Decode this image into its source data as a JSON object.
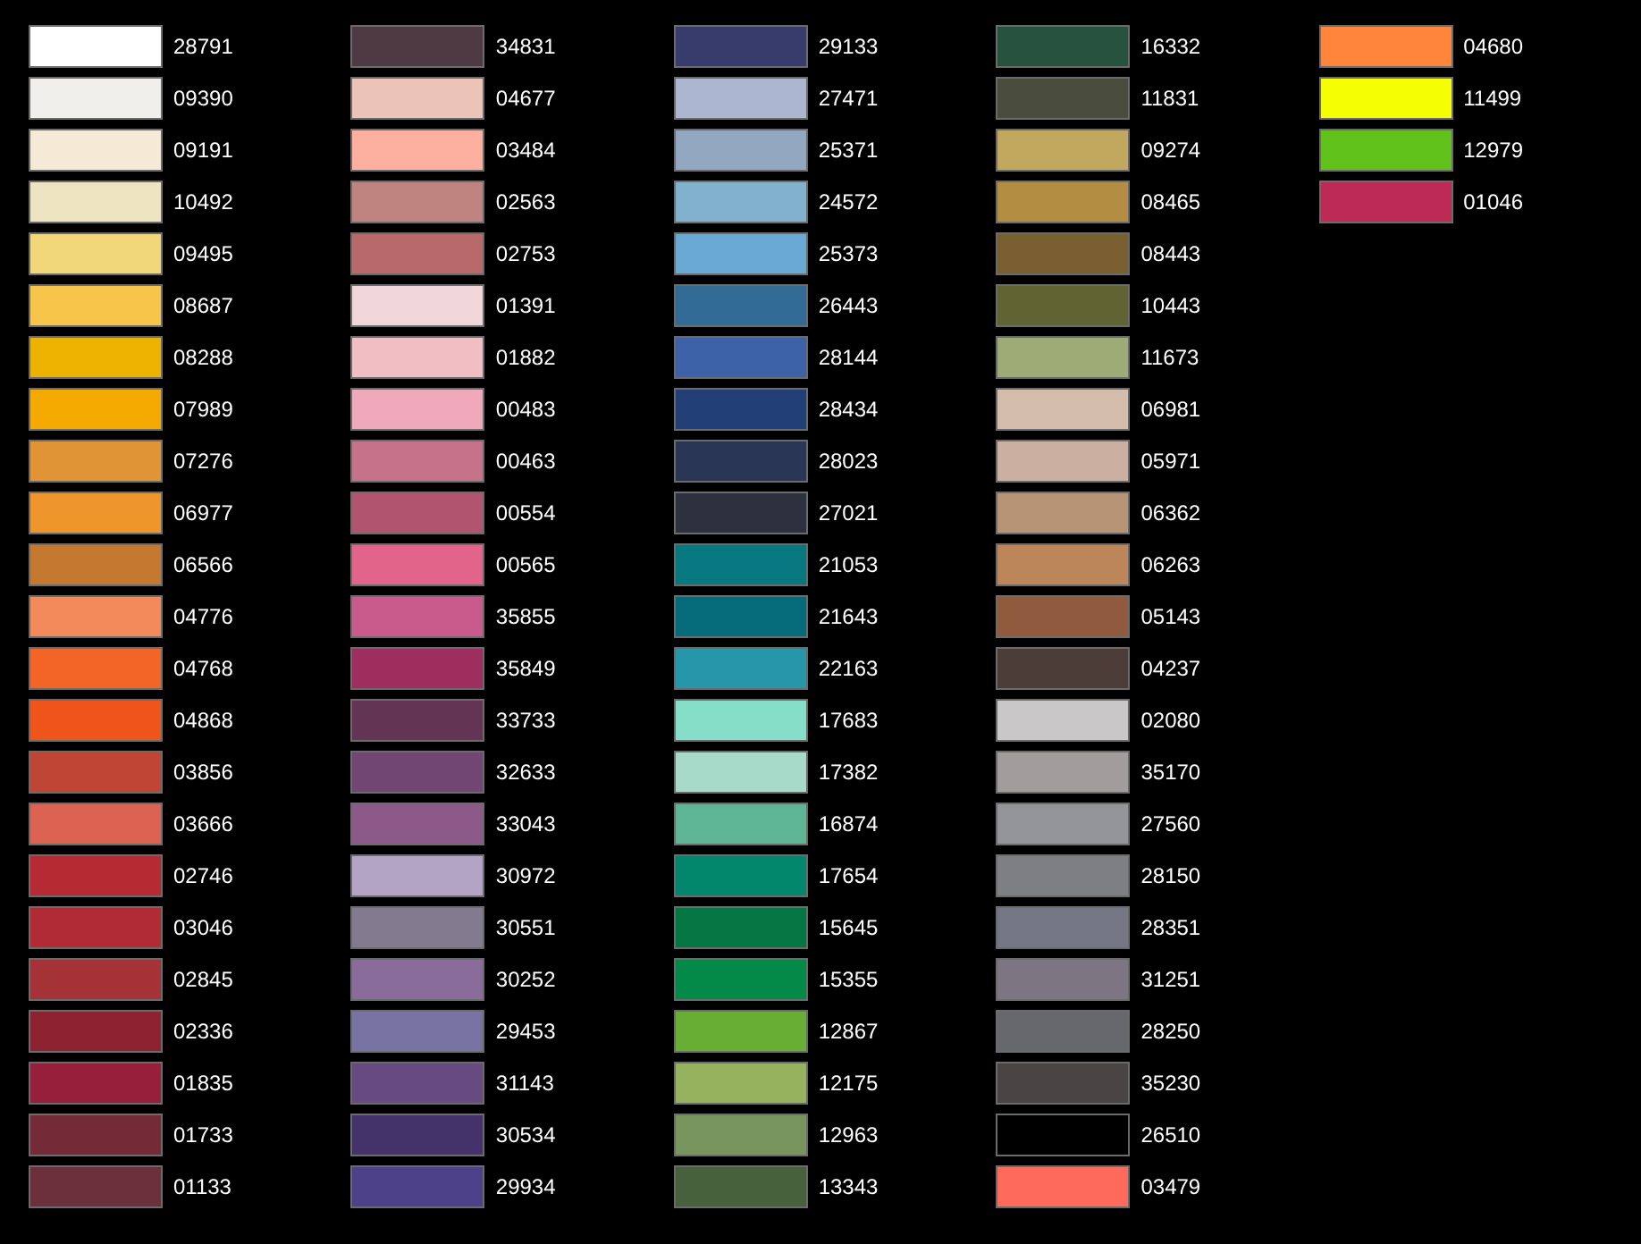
{
  "columns": [
    [
      {
        "code": "28791",
        "color": "#ffffff"
      },
      {
        "code": "09390",
        "color": "#f0efeb"
      },
      {
        "code": "09191",
        "color": "#f5ead6"
      },
      {
        "code": "10492",
        "color": "#ede5c2"
      },
      {
        "code": "09495",
        "color": "#f1d77a"
      },
      {
        "code": "08687",
        "color": "#f7c54a"
      },
      {
        "code": "08288",
        "color": "#eeb200"
      },
      {
        "code": "07989",
        "color": "#f4aa00"
      },
      {
        "code": "07276",
        "color": "#e09435"
      },
      {
        "code": "06977",
        "color": "#ee962c"
      },
      {
        "code": "06566",
        "color": "#c47830"
      },
      {
        "code": "04776",
        "color": "#f38a5c"
      },
      {
        "code": "04768",
        "color": "#f26526"
      },
      {
        "code": "04868",
        "color": "#ef541b"
      },
      {
        "code": "03856",
        "color": "#bf4535"
      },
      {
        "code": "03666",
        "color": "#dc6251"
      },
      {
        "code": "02746",
        "color": "#b62a34"
      },
      {
        "code": "03046",
        "color": "#b12b35"
      },
      {
        "code": "02845",
        "color": "#a53236"
      },
      {
        "code": "02336",
        "color": "#8d2231"
      },
      {
        "code": "01835",
        "color": "#961f3b"
      },
      {
        "code": "01733",
        "color": "#742a37"
      },
      {
        "code": "01133",
        "color": "#6c2f3c"
      }
    ],
    [
      {
        "code": "34831",
        "color": "#4f3a44"
      },
      {
        "code": "04677",
        "color": "#ecc3b7"
      },
      {
        "code": "03484",
        "color": "#fdb0a0"
      },
      {
        "code": "02563",
        "color": "#c08480"
      },
      {
        "code": "02753",
        "color": "#b76a69"
      },
      {
        "code": "01391",
        "color": "#f1d6d9"
      },
      {
        "code": "01882",
        "color": "#f1bec3"
      },
      {
        "code": "00483",
        "color": "#efa9bb"
      },
      {
        "code": "00463",
        "color": "#c6728a"
      },
      {
        "code": "00554",
        "color": "#b05470"
      },
      {
        "code": "00565",
        "color": "#e2648a"
      },
      {
        "code": "35855",
        "color": "#c95a8c"
      },
      {
        "code": "35849",
        "color": "#9d2e5d"
      },
      {
        "code": "33733",
        "color": "#643455"
      },
      {
        "code": "32633",
        "color": "#724672"
      },
      {
        "code": "33043",
        "color": "#8d5988"
      },
      {
        "code": "30972",
        "color": "#b3a4c6"
      },
      {
        "code": "30551",
        "color": "#827b8f"
      },
      {
        "code": "30252",
        "color": "#8a6c9c"
      },
      {
        "code": "29453",
        "color": "#7873a3"
      },
      {
        "code": "31143",
        "color": "#674a80"
      },
      {
        "code": "30534",
        "color": "#44336a"
      },
      {
        "code": "29934",
        "color": "#4d428a"
      }
    ],
    [
      {
        "code": "29133",
        "color": "#373c6c"
      },
      {
        "code": "27471",
        "color": "#acb6d0"
      },
      {
        "code": "25371",
        "color": "#91a8c0"
      },
      {
        "code": "24572",
        "color": "#81b1cd"
      },
      {
        "code": "25373",
        "color": "#6aa9d4"
      },
      {
        "code": "26443",
        "color": "#336b97"
      },
      {
        "code": "28144",
        "color": "#3e62a8"
      },
      {
        "code": "28434",
        "color": "#213f76"
      },
      {
        "code": "28023",
        "color": "#2a3656"
      },
      {
        "code": "27021",
        "color": "#2c313d"
      },
      {
        "code": "21053",
        "color": "#077880"
      },
      {
        "code": "21643",
        "color": "#056b7b"
      },
      {
        "code": "22163",
        "color": "#2697aa"
      },
      {
        "code": "17683",
        "color": "#84dec8"
      },
      {
        "code": "17382",
        "color": "#a7dac8"
      },
      {
        "code": "16874",
        "color": "#5fb697"
      },
      {
        "code": "17654",
        "color": "#02866c"
      },
      {
        "code": "15645",
        "color": "#037644"
      },
      {
        "code": "15355",
        "color": "#038a48"
      },
      {
        "code": "12867",
        "color": "#69ae34"
      },
      {
        "code": "12175",
        "color": "#95b35e"
      },
      {
        "code": "12963",
        "color": "#78955e"
      },
      {
        "code": "13343",
        "color": "#47613c"
      }
    ],
    [
      {
        "code": "16332",
        "color": "#27523d"
      },
      {
        "code": "11831",
        "color": "#4a4c3d"
      },
      {
        "code": "09274",
        "color": "#c2a75e"
      },
      {
        "code": "08465",
        "color": "#b28d42"
      },
      {
        "code": "08443",
        "color": "#7a5f30"
      },
      {
        "code": "10443",
        "color": "#606432"
      },
      {
        "code": "11673",
        "color": "#9dac76"
      },
      {
        "code": "06981",
        "color": "#d4bdaa"
      },
      {
        "code": "05971",
        "color": "#cbb0a1"
      },
      {
        "code": "06362",
        "color": "#b89477"
      },
      {
        "code": "06263",
        "color": "#bc865a"
      },
      {
        "code": "05143",
        "color": "#905a3f"
      },
      {
        "code": "04237",
        "color": "#4c3d39"
      },
      {
        "code": "02080",
        "color": "#cac7c8"
      },
      {
        "code": "35170",
        "color": "#a29c9c"
      },
      {
        "code": "27560",
        "color": "#949599"
      },
      {
        "code": "28150",
        "color": "#7d7f83"
      },
      {
        "code": "28351",
        "color": "#767784"
      },
      {
        "code": "31251",
        "color": "#7d7581"
      },
      {
        "code": "28250",
        "color": "#66686e"
      },
      {
        "code": "35230",
        "color": "#4a4445"
      },
      {
        "code": "26510",
        "color": "#000000"
      },
      {
        "code": "03479",
        "color": "#ff6b5b"
      }
    ],
    [
      {
        "code": "04680",
        "color": "#ff853a"
      },
      {
        "code": "11499",
        "color": "#f6fe04"
      },
      {
        "code": "12979",
        "color": "#60c21a"
      },
      {
        "code": "01046",
        "color": "#bd2a55"
      }
    ]
  ]
}
